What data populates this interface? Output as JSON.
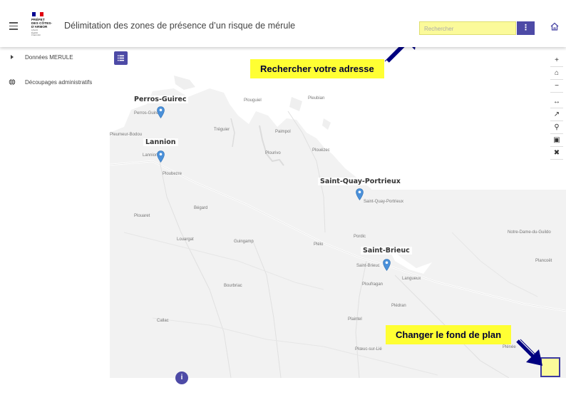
{
  "header": {
    "logo": {
      "lines": [
        "PRÉFET",
        "DES CÔTES-",
        "D'ARMOR"
      ],
      "motto": [
        "Liberté",
        "Égalité",
        "Fraternité"
      ]
    },
    "title": "Délimitation des zones de présence d’un risque de mérule",
    "search_placeholder": "Rechercher",
    "search_menu_glyph": "⋮"
  },
  "sidebar": {
    "items": [
      {
        "label": "Données MERULE",
        "icon": "caret-right-icon"
      },
      {
        "label": "Découpages administratifs",
        "icon": "globe-icon"
      }
    ]
  },
  "map": {
    "toolbar": [
      {
        "name": "zoom-in-button",
        "glyph": "+"
      },
      {
        "name": "home-view-button",
        "glyph": "⌂"
      },
      {
        "name": "zoom-out-button",
        "glyph": "−"
      },
      {
        "name": "measure-button",
        "glyph": "↔"
      },
      {
        "name": "share-button",
        "glyph": "↗"
      },
      {
        "name": "locate-button",
        "glyph": "⚲"
      },
      {
        "name": "export-image-button",
        "glyph": "▣"
      },
      {
        "name": "close-tools-button",
        "glyph": "✖"
      }
    ],
    "cities": [
      {
        "name": "Perros-Guirec"
      },
      {
        "name": "Lannion"
      },
      {
        "name": "Saint-Quay-Portrieux"
      },
      {
        "name": "Saint-Brieuc"
      }
    ],
    "places": [
      "Plouguiel",
      "Pleumeur-Bodou",
      "Perros-Guirec",
      "Lannion",
      "Tréguier",
      "Paimpol",
      "Pleubian",
      "Plourivo",
      "Ploubezre",
      "Plouézec",
      "Saint-Quay-Portrieux",
      "Bégard",
      "Plouaret",
      "Louargat",
      "Guingamp",
      "Pordic",
      "Plélo",
      "Saint-Brieuc",
      "Ploufragan",
      "Langueux",
      "Bourbriac",
      "Plédran",
      "Plaintel",
      "Callac",
      "Plœuc-sur-Lié",
      "Notre-Dame-du-Guildo",
      "Plancoët",
      "Plénée"
    ],
    "info_glyph": "i"
  },
  "callouts": {
    "search": "Rechercher votre adresse",
    "basemap": "Changer le fond de plan"
  },
  "colors": {
    "accent": "#4d4aa6",
    "highlight": "#ffff33",
    "search_bg": "#fbfa9a",
    "arrow": "#000080",
    "pin": "#4a90d9"
  }
}
